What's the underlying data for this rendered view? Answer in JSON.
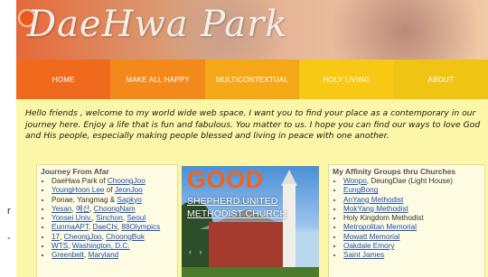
{
  "header": {
    "site_title": "DaeHwa Park"
  },
  "nav": {
    "items": [
      "HOME",
      "MAKE ALL HAPPY",
      "MULTICONTEXTUAL",
      "HOLY LIVING",
      "ABOUT"
    ]
  },
  "welcome": {
    "text": "Hello friends , welcome to my world wide web space. I want you to find your place as a contemporary in our journey here. Enjoy a life that is fun and fabulous. You matter to us. I hope you can find our ways to love God and His people, especially making people blessed and living in peace with one another."
  },
  "journey": {
    "title": "Journey From Afar",
    "items": [
      {
        "pre": "DaeHwa Park of ",
        "links": [
          "ChoongJoo"
        ],
        "seps": []
      },
      {
        "pre": "",
        "links": [
          "YoungHoon Lee",
          "JeonJoo"
        ],
        "seps": [
          " of "
        ]
      },
      {
        "pre": "Ponae, Yangmag & ",
        "links": [
          "Sapkyo"
        ],
        "seps": []
      },
      {
        "pre": "",
        "links": [
          "Yesan",
          "예산",
          "ChoongNam"
        ],
        "seps": [
          ", ",
          ", "
        ]
      },
      {
        "pre": "",
        "links": [
          "Yonsei Univ.",
          "Sinchon",
          "Seoul"
        ],
        "seps": [
          ", ",
          ", "
        ]
      },
      {
        "pre": "",
        "links": [
          "EunmaAPT",
          "DaeChi",
          "88Olympics"
        ],
        "seps": [
          ", ",
          ", "
        ]
      },
      {
        "pre": "",
        "links": [
          "17",
          "CheongJoo",
          "ChoongBuk"
        ],
        "seps": [
          ", ",
          ", "
        ]
      },
      {
        "pre": "",
        "links": [
          "WTS",
          "Washington, D.C."
        ],
        "seps": [
          ", "
        ]
      },
      {
        "pre": "",
        "links": [
          "Greenbelt",
          "Maryland"
        ],
        "seps": [
          ", "
        ]
      }
    ]
  },
  "slideshow": {
    "headline": "GOOD",
    "caption_line1": "SHEPHERD UNITED",
    "caption_line2": "METHODIST CHURCH",
    "nav_arrows": "‹ ›"
  },
  "affinity": {
    "title": "My Affinity Groups thru Churches",
    "items": [
      {
        "links": [
          "Wonpo"
        ],
        "suffix": ", DeungDae (Light House)"
      },
      {
        "links": [
          "EungBong"
        ],
        "suffix": ""
      },
      {
        "links": [
          "AnYang Methodist"
        ],
        "suffix": ""
      },
      {
        "links": [
          "MokYang Methodist"
        ],
        "suffix": ""
      },
      {
        "links": [],
        "text": "Holy Kingdom Methodist",
        "suffix": ""
      },
      {
        "links": [
          "Metropolitan Memorial"
        ],
        "suffix": ""
      },
      {
        "links": [
          "Mowatt Memorial"
        ],
        "suffix": ""
      },
      {
        "links": [
          "Oakdale Emory"
        ],
        "suffix": ""
      },
      {
        "links": [
          "Saint James"
        ],
        "suffix": ""
      }
    ]
  },
  "sidebar_marks": {
    "a": "r",
    "b": "-"
  },
  "colors": {
    "background": "#fbf6a8",
    "nav_home": "#f06a1e",
    "nav_happy": "#f3891b",
    "nav_multi": "#f5a817",
    "nav_holy": "#f7c814",
    "nav_about": "#f0c412",
    "link": "#1d4fb8",
    "headline": "#f0641e"
  }
}
